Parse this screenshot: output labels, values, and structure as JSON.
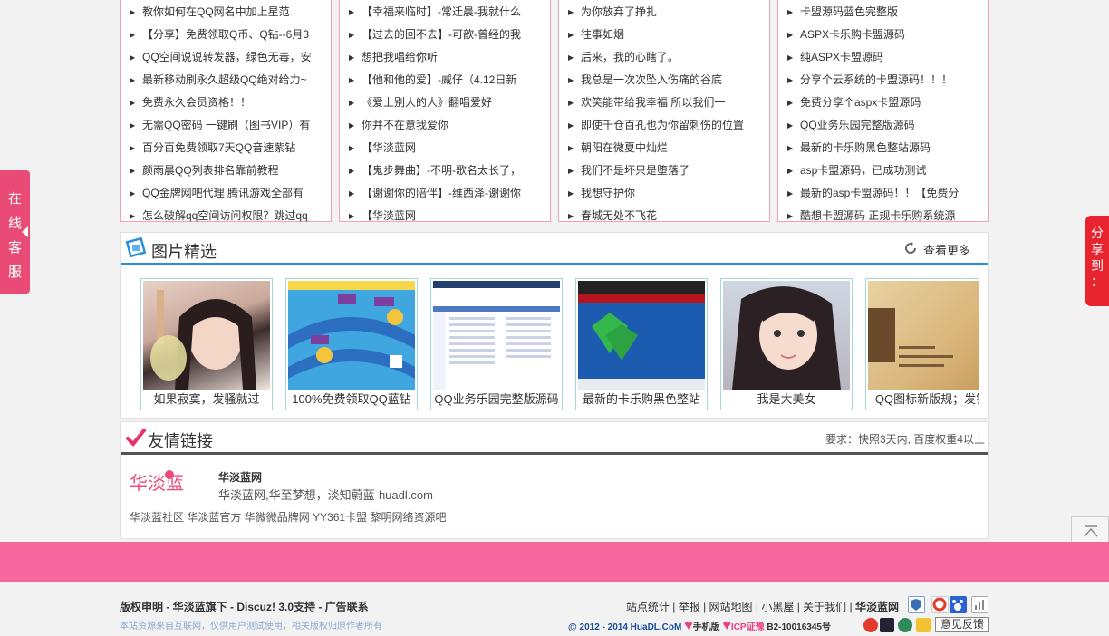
{
  "lists": [
    [
      "教你如何在QQ网名中加上星范",
      "【分享】免费领取Q币、Q钻--6月3",
      "QQ空间说说转发器，绿色无毒，安",
      "最新移动刷永久超级QQ绝对给力~",
      "免费永久会员资格！！",
      "无需QQ密码 一键刷（图书VIP）有",
      "百分百免费领取7天QQ音速紫钻",
      "颜雨晨QQ列表排名靠前教程",
      "QQ金牌网吧代理 腾讯游戏全部有",
      "怎么破解qq空间访问权限？跳过qq"
    ],
    [
      "【幸福来临时】-常迁晨-我就什么",
      "【过去的回不去】-可歆-曾经的我",
      "想把我唱给你听",
      "【他和他的爱】-威仔（4.12日新",
      "《爱上别人的人》翻唱爱好",
      "你并不在意我爱你",
      "【华淡蓝网",
      "【鬼步舞曲】-不明-歌名太长了，",
      "【谢谢你的陪伴】-维西泽-谢谢你",
      "【华淡蓝网"
    ],
    [
      "为你放弃了挣扎",
      "往事如烟",
      "后来，我的心瞎了。",
      "我总是一次次坠入伤痛的谷底",
      "欢笑能带给我幸福 所以我们一",
      "即使千仓百孔也为你留刺伤的位置",
      "朝阳在微夏中灿烂",
      "我们不是坏只是堕落了",
      "我想守护你",
      "春城无处不飞花"
    ],
    [
      "卡盟源码蓝色完整版",
      "ASPX卡乐购卡盟源码",
      "纯ASPX卡盟源码",
      "分享个云系统的卡盟源码！！！",
      "免费分享个aspx卡盟源码",
      "QQ业务乐园完整版源码",
      "最新的卡乐购黑色整站源码",
      "asp卡盟源码，已成功测试",
      "最新的asp卡盟源码！！【免费分",
      "酷想卡盟源码 正规卡乐购系统源"
    ]
  ],
  "pictures": {
    "title": "图片精选",
    "more": "查看更多",
    "items": [
      {
        "caption": "如果寂寞，发骚就过"
      },
      {
        "caption": "100%免费领取QQ蓝钻"
      },
      {
        "caption": "QQ业务乐园完整版源码"
      },
      {
        "caption": "最新的卡乐购黑色整站"
      },
      {
        "caption": "我是大美女"
      },
      {
        "caption": "QQ图标新版规；发钻"
      }
    ]
  },
  "links": {
    "title": "友情链接",
    "requirement": "要求：快照3天内, 百度权重4以上",
    "featured_name": "华淡蓝网",
    "featured_desc": "华淡蓝网,华至梦想，淡知蔚蓝-huadl.com",
    "logo_text": "华淡蓝",
    "items": [
      "华淡蓝社区",
      "华淡蓝官方",
      "华微微品牌网",
      "YY361卡盟",
      "黎明网络资源吧"
    ]
  },
  "side": {
    "service": "在线客服",
    "share": "分享到："
  },
  "footer": {
    "left": "版权申明 - 华淡蓝旗下 - Discuz! 3.0支持 - 广告联系",
    "note": "本站资源来自互联网，仅供用户测试使用，相关版权归原作者所有",
    "links": [
      "站点统计",
      "举报",
      "网站地图",
      "小黑屋",
      "关于我们"
    ],
    "site": "华淡蓝网",
    "copyright": "@ 2012 - 2014 HuaDL.CoM",
    "mobile": "手机版",
    "icp": "ICP证豫",
    "icp_no": "B2-10016345号",
    "feedback": "意见反馈"
  },
  "colors": {
    "pink_band": "#f7679e",
    "blue_accent": "#2a8fd6",
    "panel_border": "#f2a1b7"
  }
}
